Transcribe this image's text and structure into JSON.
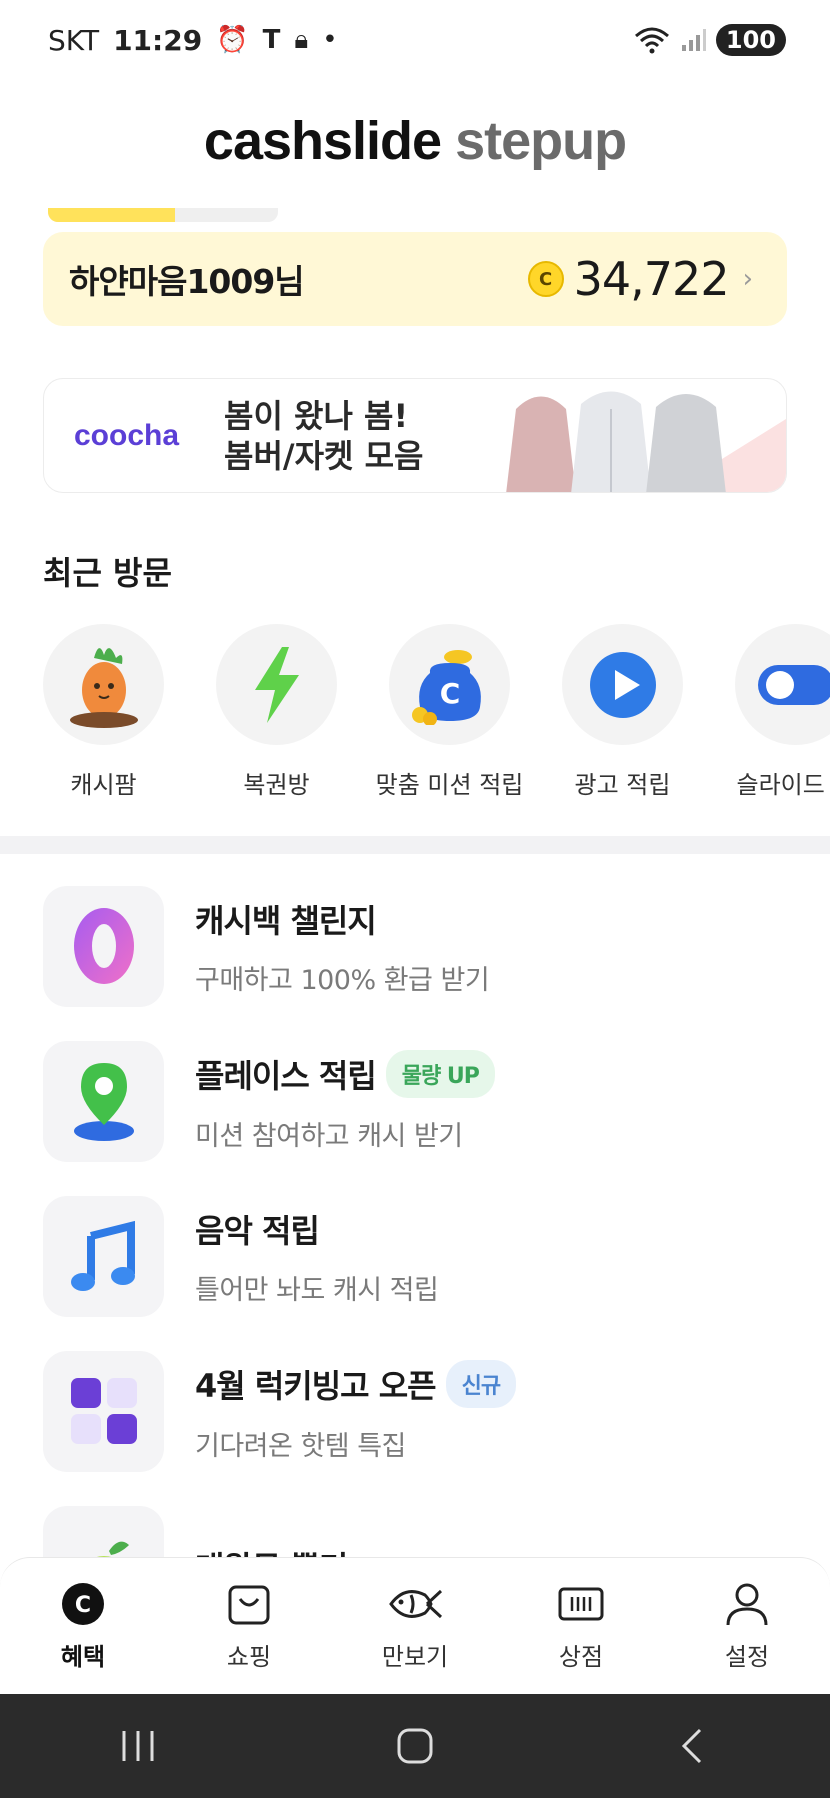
{
  "status_bar": {
    "carrier": "SKT",
    "time": "11:29",
    "battery": "100"
  },
  "header": {
    "brand_word1": "cashslide",
    "brand_word2": "stepup"
  },
  "user_card": {
    "name": "하얀마음1009님",
    "points": "34,722",
    "coin_symbol": "C"
  },
  "banner": {
    "brand": "coocha",
    "line1": "봄이 왔나 봄!",
    "line2": "봄버/자켓 모음"
  },
  "recent": {
    "title": "최근 방문",
    "items": [
      {
        "label": "캐시팜",
        "icon": "carrot-icon"
      },
      {
        "label": "복권방",
        "icon": "lightning-icon"
      },
      {
        "label": "맞춤 미션 적립",
        "icon": "coin-pouch-icon"
      },
      {
        "label": "광고 적립",
        "icon": "play-icon"
      },
      {
        "label": "슬라이드 적",
        "icon": "toggle-icon"
      }
    ]
  },
  "list": [
    {
      "title": "캐시백 챌린지",
      "subtitle": "구매하고 100% 환급 받기",
      "tag": "",
      "icon": "zero-icon"
    },
    {
      "title": "플레이스 적립",
      "subtitle": "미션 참여하고 캐시 받기",
      "tag": "물량 UP",
      "icon": "map-pin-icon"
    },
    {
      "title": "음악 적립",
      "subtitle": "틀어만 놔도 캐시 적립",
      "tag": "",
      "icon": "music-note-icon"
    },
    {
      "title": "4월 럭키빙고 오픈",
      "subtitle": "기다려온 핫템 특집",
      "tag": "신규",
      "icon": "bingo-grid-icon"
    },
    {
      "title": "대왕무 뽑기",
      "subtitle": "",
      "tag": "",
      "icon": "radish-icon"
    }
  ],
  "bottom_nav": [
    {
      "label": "혜택",
      "icon": "cash-c-icon",
      "active": true
    },
    {
      "label": "쇼핑",
      "icon": "shopping-bag-icon",
      "active": false
    },
    {
      "label": "만보기",
      "icon": "fish-icon",
      "active": false
    },
    {
      "label": "상점",
      "icon": "ticket-icon",
      "active": false
    },
    {
      "label": "설정",
      "icon": "person-icon",
      "active": false
    }
  ],
  "colors": {
    "accent_yellow": "#ffe25b",
    "card_yellow": "#fff8d6",
    "brand_purple": "#5b3fd6"
  }
}
